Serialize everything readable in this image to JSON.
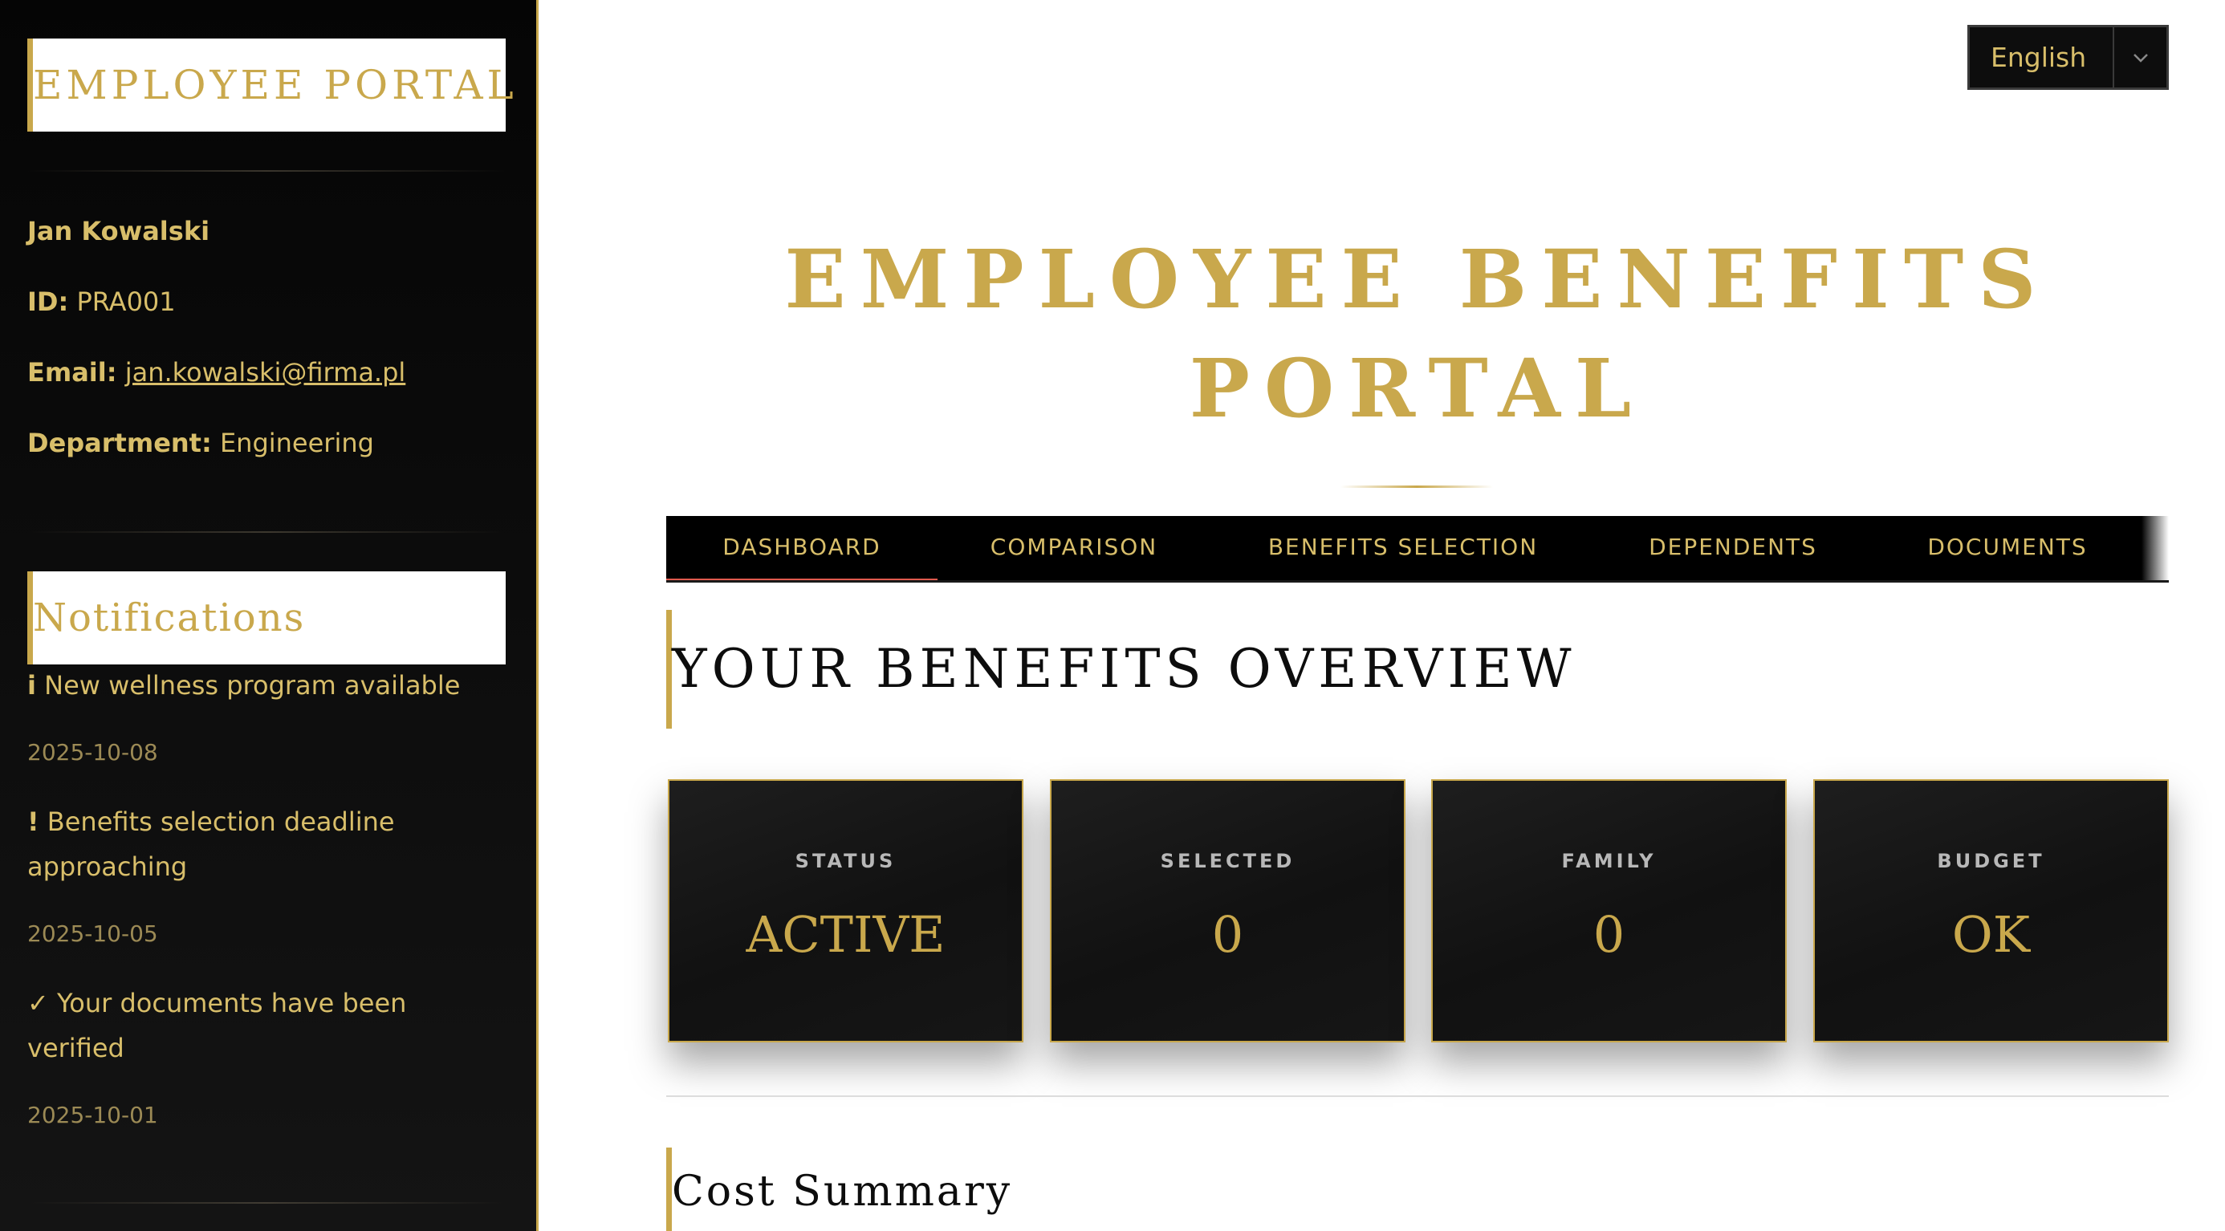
{
  "sidebar": {
    "portal_title": "EMPLOYEE PORTAL",
    "user": {
      "name": "Jan Kowalski",
      "id_label": "ID:",
      "id_value": "PRA001",
      "email_label": "Email:",
      "email_value": "jan.kowalski@firma.pl",
      "department_label": "Department:",
      "department_value": "Engineering"
    },
    "notifications_title": "Notifications",
    "notifications": [
      {
        "glyph": "i",
        "text": "New wellness program available",
        "date": "2025-10-08"
      },
      {
        "glyph": "!",
        "text": "Benefits selection deadline approaching",
        "date": "2025-10-05"
      },
      {
        "glyph": "✓",
        "text": "Your documents have been verified",
        "date": "2025-10-01"
      }
    ]
  },
  "language": {
    "selected": "English",
    "icon": "chevron-down-icon"
  },
  "header": {
    "title": "EMPLOYEE BENEFITS PORTAL"
  },
  "tabs": [
    {
      "label": "DASHBOARD",
      "active": true
    },
    {
      "label": "COMPARISON",
      "active": false
    },
    {
      "label": "BENEFITS SELECTION",
      "active": false
    },
    {
      "label": "DEPENDENTS",
      "active": false
    },
    {
      "label": "DOCUMENTS",
      "active": false
    }
  ],
  "overview": {
    "heading": "YOUR BENEFITS OVERVIEW",
    "cards": [
      {
        "label": "STATUS",
        "value": "ACTIVE"
      },
      {
        "label": "SELECTED",
        "value": "0"
      },
      {
        "label": "FAMILY",
        "value": "0"
      },
      {
        "label": "BUDGET",
        "value": "OK"
      }
    ]
  },
  "cost_summary": {
    "heading": "Cost Summary"
  },
  "colors": {
    "accent_gold": "#C9A84C",
    "active_tab_underline": "#E05A4E",
    "sidebar_bg": "#0b0b0b"
  }
}
